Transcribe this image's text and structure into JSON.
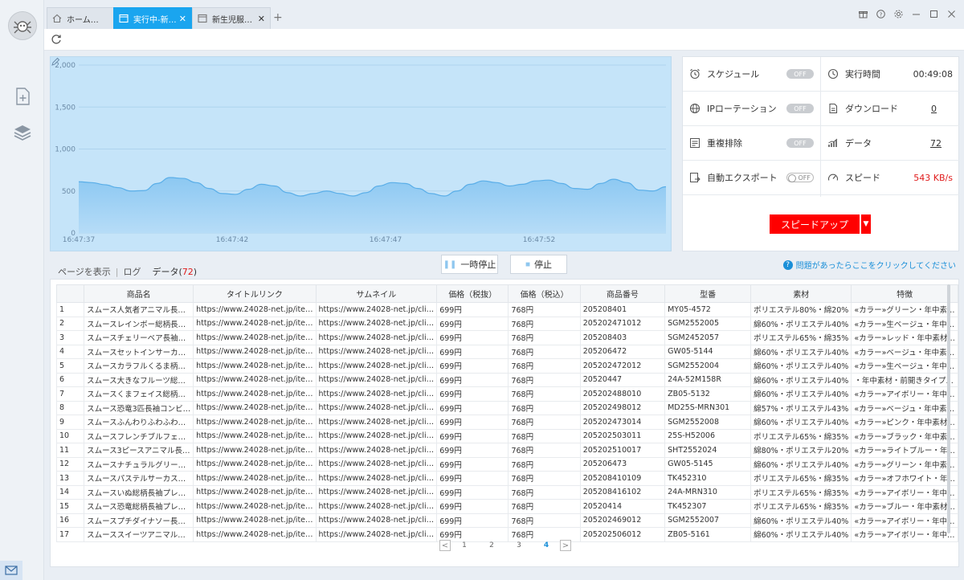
{
  "tabs": [
    {
      "label": "ホーム…",
      "icon": "home-icon",
      "closable": false,
      "active": false
    },
    {
      "label": "実行中-新…",
      "icon": "page-icon",
      "closable": true,
      "active": true
    },
    {
      "label": "新生児服…",
      "icon": "page-icon",
      "closable": true,
      "active": false
    }
  ],
  "new_tab_label": "+",
  "chart_data": {
    "type": "area",
    "x_ticks": [
      "16:47:37",
      "16:47:42",
      "16:47:47",
      "16:47:52"
    ],
    "y_ticks": [
      "2,000",
      "1,500",
      "1,000",
      "500",
      "0"
    ],
    "ylim": [
      0,
      2000
    ],
    "grid": true,
    "series": [
      {
        "values": [
          610,
          600,
          575,
          540,
          500,
          505,
          590,
          660,
          650,
          600,
          530,
          470,
          460,
          520,
          580,
          560,
          480,
          440,
          470,
          500,
          470,
          440,
          480,
          560,
          600,
          590,
          530,
          470,
          440,
          500,
          580,
          620,
          600,
          560,
          580,
          620,
          630,
          590,
          530,
          520,
          590,
          640,
          600,
          510,
          500,
          550
        ]
      }
    ],
    "fill_color": "#8cc8f2",
    "line_color": "#5aaee8"
  },
  "stats": {
    "schedule": {
      "label": "スケジュール",
      "toggle": "OFF",
      "icon": "alarm-clock-icon"
    },
    "ip_rotation": {
      "label": "IPローテーション",
      "toggle": "OFF",
      "icon": "globe-icon"
    },
    "dedupe": {
      "label": "重複排除",
      "toggle": "OFF",
      "icon": "list-filter-icon"
    },
    "auto_export": {
      "label": "自動エクスポート",
      "toggle": "OFF",
      "icon": "export-icon"
    },
    "run_time": {
      "label": "実行時間",
      "value": "00:49:08",
      "icon": "clock-icon"
    },
    "download": {
      "label": "ダウンロード",
      "value": "0",
      "icon": "document-icon"
    },
    "data": {
      "label": "データ",
      "value": "72",
      "icon": "bar-chart-icon"
    },
    "speed": {
      "label": "スピード",
      "value": "543 KB/s",
      "icon": "speedometer-icon"
    },
    "speed_up_label": "スピードアップ"
  },
  "view_tabs": {
    "page": "ページを表示",
    "log": "ログ",
    "data": "データ",
    "data_count_open": "(",
    "data_count": "72",
    "data_count_close": ")"
  },
  "controls": {
    "pause": "一時停止",
    "stop": "停止"
  },
  "help_text": "問題があったらここをクリックしてください",
  "table": {
    "columns": [
      "",
      "商品名",
      "タイトルリンク",
      "サムネイル",
      "価格（税抜）",
      "価格（税込）",
      "商品番号",
      "型番",
      "素材",
      "特徴"
    ],
    "rows": [
      [
        "1",
        "スムース人気者アニマル長…",
        "https://www.24028-net.jp/ite…",
        "https://www.24028-net.jp/cli…",
        "699円",
        "768円",
        "205208401",
        "MY05-4572",
        "ポリエステル80%・綿20%",
        "«カラー»グリーン・年中素…"
      ],
      [
        "2",
        "スムースレインボー総柄長…",
        "https://www.24028-net.jp/ite…",
        "https://www.24028-net.jp/cli…",
        "699円",
        "768円",
        "205202471012",
        "SGM2552005",
        "綿60%・ポリエステル40%",
        "«カラー»生ベージュ・年中…"
      ],
      [
        "3",
        "スムースチェリーベア長袖…",
        "https://www.24028-net.jp/ite…",
        "https://www.24028-net.jp/cli…",
        "699円",
        "768円",
        "205208403",
        "SGM2452057",
        "ポリエステル65%・綿35%",
        "«カラー»レッド・年中素材…"
      ],
      [
        "4",
        "スムースセットインサーカ…",
        "https://www.24028-net.jp/ite…",
        "https://www.24028-net.jp/cli…",
        "699円",
        "768円",
        "205206472",
        "GW05-5144",
        "綿60%・ポリエステル40%",
        "«カラー»ベージュ・年中素…"
      ],
      [
        "5",
        "スムースカラフルくるま柄…",
        "https://www.24028-net.jp/ite…",
        "https://www.24028-net.jp/cli…",
        "699円",
        "768円",
        "205202472012",
        "SGM2552004",
        "綿60%・ポリエステル40%",
        "«カラー»生ベージュ・年中…"
      ],
      [
        "6",
        "スムース大きなフルーツ総…",
        "https://www.24028-net.jp/ite…",
        "https://www.24028-net.jp/cli…",
        "699円",
        "768円",
        "20520447",
        "24A-52M158R",
        "綿60%・ポリエステル40%",
        "・年中素材・前開きタイプ…"
      ],
      [
        "7",
        "スムースくまフェイス総柄…",
        "https://www.24028-net.jp/ite…",
        "https://www.24028-net.jp/cli…",
        "699円",
        "768円",
        "205202488010",
        "ZB05-5132",
        "綿60%・ポリエステル40%",
        "«カラー»アイボリー・年中…"
      ],
      [
        "8",
        "スムース恐竜3匹長袖コンビ…",
        "https://www.24028-net.jp/ite…",
        "https://www.24028-net.jp/cli…",
        "699円",
        "768円",
        "205202498012",
        "MD25S-MRN301",
        "綿57%・ポリエステル43%",
        "«カラー»ベージュ・年中素…"
      ],
      [
        "9",
        "スムースふんわりふわふわ…",
        "https://www.24028-net.jp/ite…",
        "https://www.24028-net.jp/cli…",
        "699円",
        "768円",
        "205202473014",
        "SGM2552008",
        "綿60%・ポリエステル40%",
        "«カラー»ピンク・年中素材…"
      ],
      [
        "10",
        "スムースフレンチブルフェ…",
        "https://www.24028-net.jp/ite…",
        "https://www.24028-net.jp/cli…",
        "699円",
        "768円",
        "205202503011",
        "25S-H52006",
        "ポリエステル65%・綿35%",
        "«カラー»ブラック・年中素…"
      ],
      [
        "11",
        "スムース3ピースアニマル長…",
        "https://www.24028-net.jp/ite…",
        "https://www.24028-net.jp/cli…",
        "699円",
        "768円",
        "205202510017",
        "SHT2552024",
        "綿80%・ポリエステル20%",
        "«カラー»ライトブルー・年…"
      ],
      [
        "12",
        "スムースナチュラルグリー…",
        "https://www.24028-net.jp/ite…",
        "https://www.24028-net.jp/cli…",
        "699円",
        "768円",
        "205206473",
        "GW05-5145",
        "綿60%・ポリエステル40%",
        "«カラー»グリーン・年中素…"
      ],
      [
        "13",
        "スムースパステルサーカス…",
        "https://www.24028-net.jp/ite…",
        "https://www.24028-net.jp/cli…",
        "699円",
        "768円",
        "205208410109",
        "TK452310",
        "ポリエステル65%・綿35%",
        "«カラー»オフホワイト・年…"
      ],
      [
        "14",
        "スムースいぬ総柄長袖プレ…",
        "https://www.24028-net.jp/ite…",
        "https://www.24028-net.jp/cli…",
        "699円",
        "768円",
        "205208416102",
        "24A-MRN310",
        "ポリエステル65%・綿35%",
        "«カラー»アイボリー・年中…"
      ],
      [
        "15",
        "スムース恐竜総柄長袖プレ…",
        "https://www.24028-net.jp/ite…",
        "https://www.24028-net.jp/cli…",
        "699円",
        "768円",
        "20520414",
        "TK452307",
        "ポリエステル65%・綿35%",
        "«カラー»ブルー・年中素材…"
      ],
      [
        "16",
        "スムースプチダイナソー長…",
        "https://www.24028-net.jp/ite…",
        "https://www.24028-net.jp/cli…",
        "699円",
        "768円",
        "205202469012",
        "SGM2552007",
        "綿60%・ポリエステル40%",
        "«カラー»アイボリー・年中…"
      ],
      [
        "17",
        "スムーススイーツアニマル…",
        "https://www.24028-net.jp/ite…",
        "https://www.24028-net.jp/cli…",
        "699円",
        "768円",
        "205202506012",
        "ZB05-5161",
        "綿60%・ポリエステル40%",
        "«カラー»アイボリー・年中…"
      ]
    ]
  },
  "pagination": {
    "pages": [
      "1",
      "2",
      "3",
      "4"
    ],
    "current": "4",
    "prev": "<",
    "next": ">"
  },
  "colors": {
    "accent": "#1aa5ef",
    "danger": "#ff0000",
    "chart_bg": "#c5e4f9"
  }
}
